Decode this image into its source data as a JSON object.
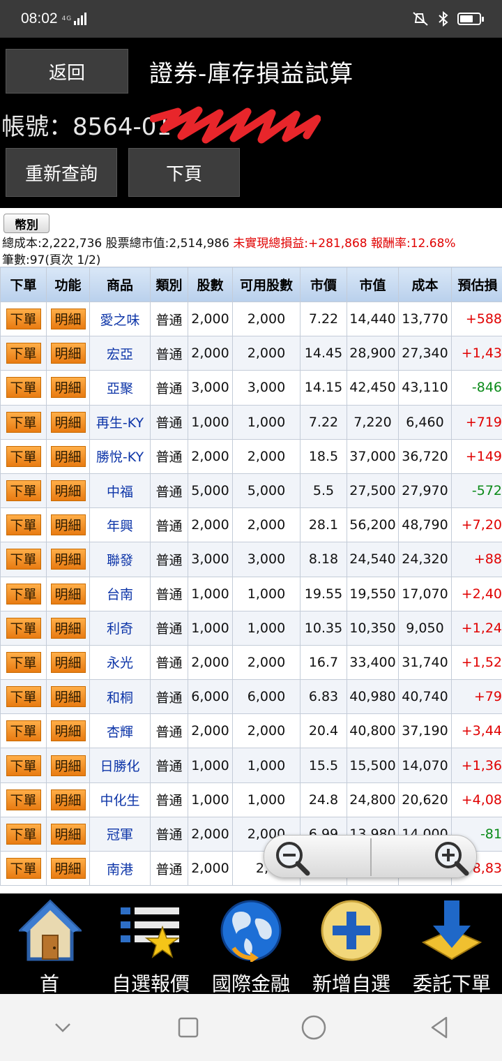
{
  "status_bar": {
    "time": "08:02",
    "network": "4G"
  },
  "header": {
    "back_label": "返回",
    "title": "證券-庫存損益試算",
    "account_label": "帳號：8564-01"
  },
  "buttons": {
    "requery": "重新查詢",
    "next_page": "下頁"
  },
  "summary": {
    "currency_button": "幣別",
    "cost_total": "總成本:2,222,736",
    "market_value_total": "股票總市值:2,514,986",
    "unrealized_pl": "未實現總損益:+281,868",
    "return_rate": "報酬率:12.68%",
    "count": "筆數:97(頁次 1/2)"
  },
  "table": {
    "headers": [
      "下單",
      "功能",
      "商品",
      "類別",
      "股數",
      "可用股數",
      "市價",
      "市值",
      "成本",
      "預估損"
    ],
    "order_label": "下單",
    "detail_label": "明細",
    "rows": [
      {
        "name": "愛之味",
        "type": "普通",
        "shares": "2,000",
        "available": "2,000",
        "price": "7.22",
        "value": "14,440",
        "cost": "13,770",
        "pl": "+588"
      },
      {
        "name": "宏亞",
        "type": "普通",
        "shares": "2,000",
        "available": "2,000",
        "price": "14.45",
        "value": "28,900",
        "cost": "27,340",
        "pl": "+1,43"
      },
      {
        "name": "亞聚",
        "type": "普通",
        "shares": "3,000",
        "available": "3,000",
        "price": "14.15",
        "value": "42,450",
        "cost": "43,110",
        "pl": "-846"
      },
      {
        "name": "再生-KY",
        "type": "普通",
        "shares": "1,000",
        "available": "1,000",
        "price": "7.22",
        "value": "7,220",
        "cost": "6,460",
        "pl": "+719"
      },
      {
        "name": "勝悅-KY",
        "type": "普通",
        "shares": "2,000",
        "available": "2,000",
        "price": "18.5",
        "value": "37,000",
        "cost": "36,720",
        "pl": "+149"
      },
      {
        "name": "中福",
        "type": "普通",
        "shares": "5,000",
        "available": "5,000",
        "price": "5.5",
        "value": "27,500",
        "cost": "27,970",
        "pl": "-572"
      },
      {
        "name": "年興",
        "type": "普通",
        "shares": "2,000",
        "available": "2,000",
        "price": "28.1",
        "value": "56,200",
        "cost": "48,790",
        "pl": "+7,20"
      },
      {
        "name": "聯發",
        "type": "普通",
        "shares": "3,000",
        "available": "3,000",
        "price": "8.18",
        "value": "24,540",
        "cost": "24,320",
        "pl": "+88"
      },
      {
        "name": "台南",
        "type": "普通",
        "shares": "1,000",
        "available": "1,000",
        "price": "19.55",
        "value": "19,550",
        "cost": "17,070",
        "pl": "+2,40"
      },
      {
        "name": "利奇",
        "type": "普通",
        "shares": "1,000",
        "available": "1,000",
        "price": "10.35",
        "value": "10,350",
        "cost": "9,050",
        "pl": "+1,24"
      },
      {
        "name": "永光",
        "type": "普通",
        "shares": "2,000",
        "available": "2,000",
        "price": "16.7",
        "value": "33,400",
        "cost": "31,740",
        "pl": "+1,52"
      },
      {
        "name": "和桐",
        "type": "普通",
        "shares": "6,000",
        "available": "6,000",
        "price": "6.83",
        "value": "40,980",
        "cost": "40,740",
        "pl": "+79"
      },
      {
        "name": "杏輝",
        "type": "普通",
        "shares": "2,000",
        "available": "2,000",
        "price": "20.4",
        "value": "40,800",
        "cost": "37,190",
        "pl": "+3,44"
      },
      {
        "name": "日勝化",
        "type": "普通",
        "shares": "1,000",
        "available": "1,000",
        "price": "15.5",
        "value": "15,500",
        "cost": "14,070",
        "pl": "+1,36"
      },
      {
        "name": "中化生",
        "type": "普通",
        "shares": "1,000",
        "available": "1,000",
        "price": "24.8",
        "value": "24,800",
        "cost": "20,620",
        "pl": "+4,08"
      },
      {
        "name": "冠軍",
        "type": "普通",
        "shares": "2,000",
        "available": "2,000",
        "price": "6.99",
        "value": "13,980",
        "cost": "14,000",
        "pl": "-81"
      },
      {
        "name": "南港",
        "type": "普通",
        "shares": "2,000",
        "available": "2,0",
        "price": "",
        "value": "",
        "cost": "",
        "pl": "8,83"
      }
    ]
  },
  "bottom_nav": [
    {
      "label": "首頁",
      "icon": "home-icon"
    },
    {
      "label": "自選報價",
      "icon": "watchlist-star-icon"
    },
    {
      "label": "國際金融",
      "icon": "globe-icon"
    },
    {
      "label": "新增自選",
      "icon": "plus-circle-icon"
    },
    {
      "label": "委託下單",
      "icon": "download-arrow-icon"
    }
  ],
  "colors": {
    "positive": "#e00000",
    "negative": "#0a8a18",
    "order_button": "#f39a2e",
    "header_bg": "#000000"
  }
}
